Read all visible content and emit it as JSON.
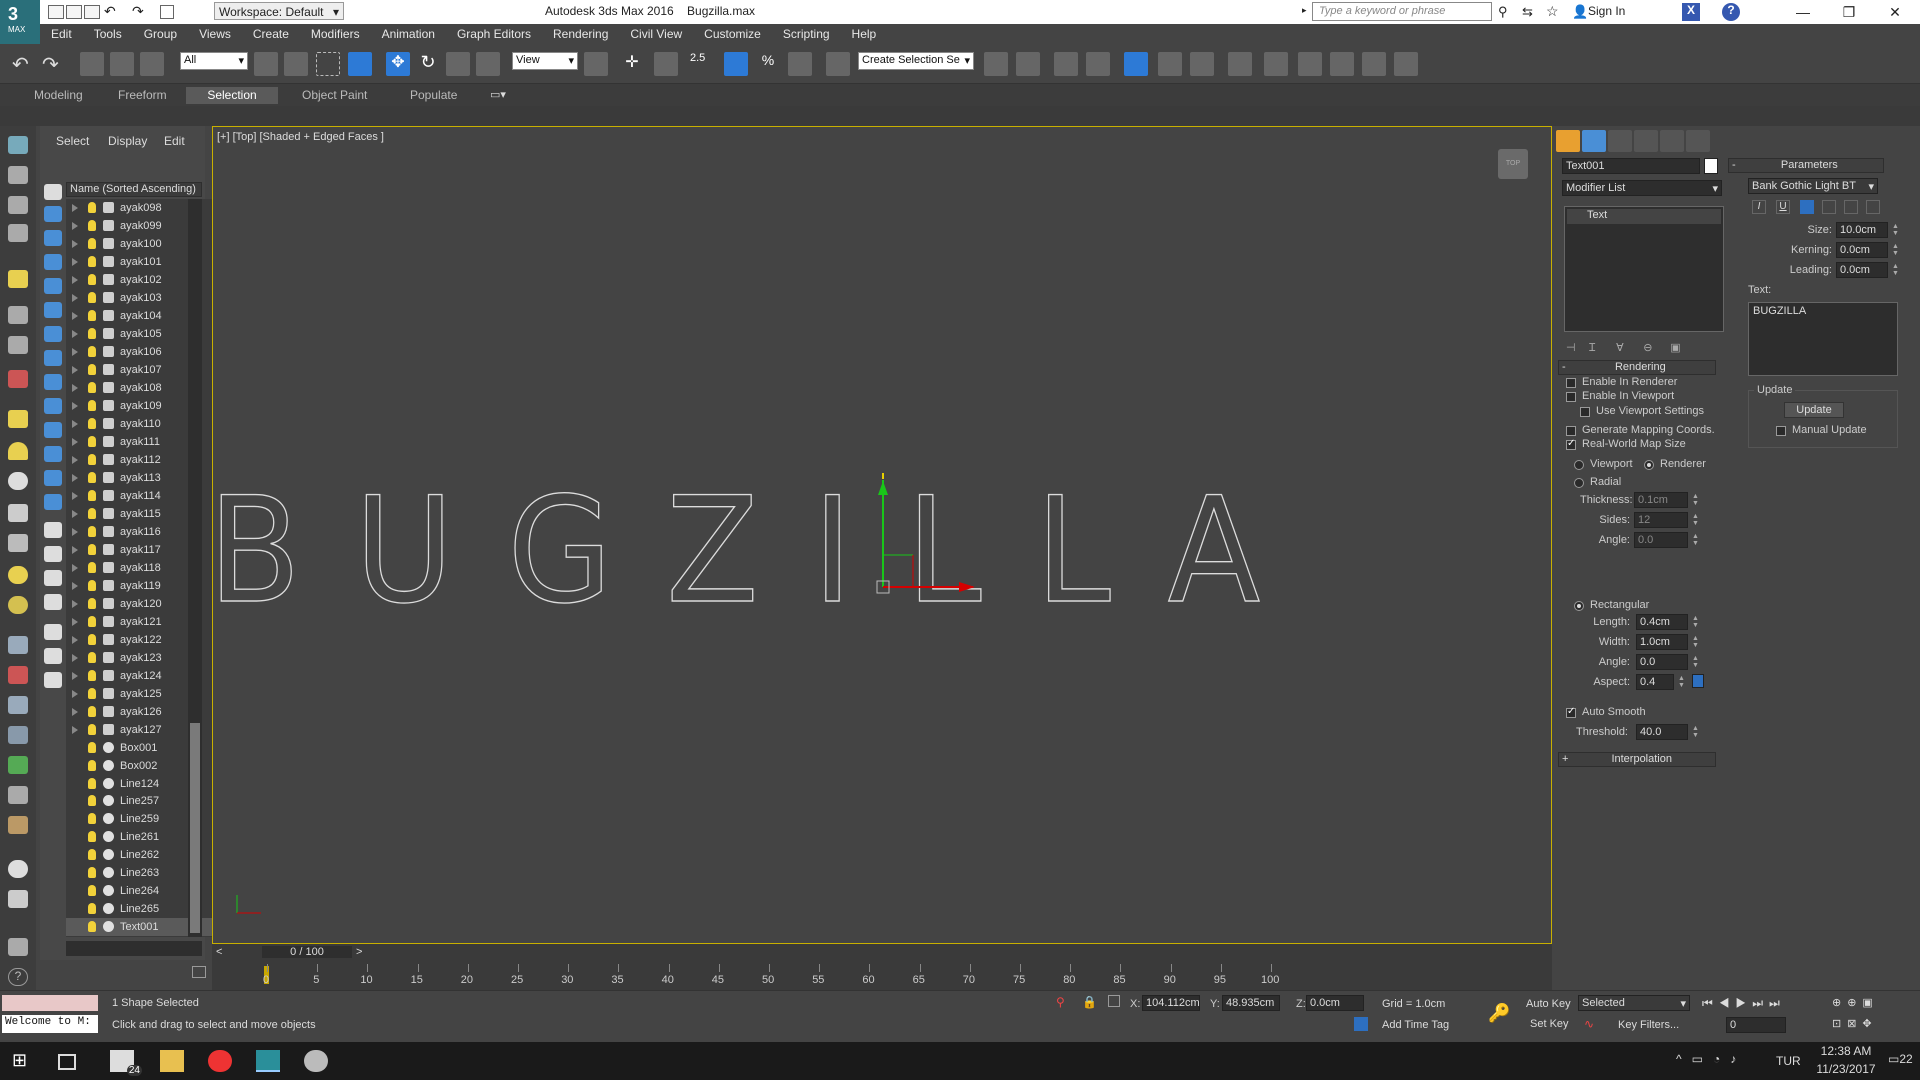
{
  "titlebar": {
    "workspace": "Workspace: Default",
    "app_title": "Autodesk 3ds Max 2016",
    "file_name": "Bugzilla.max",
    "search_placeholder": "Type a keyword or phrase",
    "signin": "Sign In"
  },
  "menu": [
    "Edit",
    "Tools",
    "Group",
    "Views",
    "Create",
    "Modifiers",
    "Animation",
    "Graph Editors",
    "Rendering",
    "Civil View",
    "Customize",
    "Scripting",
    "Help"
  ],
  "toolbar": {
    "filter_select": "All",
    "view_select": "View",
    "snap_value": "2.5",
    "selection_set": "Create Selection Se"
  },
  "ribbon": {
    "tabs": [
      "Modeling",
      "Freeform",
      "Selection",
      "Object Paint",
      "Populate"
    ],
    "active": "Selection"
  },
  "explorer": {
    "tabs": [
      "Select",
      "Display",
      "Edit"
    ],
    "header": "Name (Sorted Ascending)",
    "items": [
      "ayak098",
      "ayak099",
      "ayak100",
      "ayak101",
      "ayak102",
      "ayak103",
      "ayak104",
      "ayak105",
      "ayak106",
      "ayak107",
      "ayak108",
      "ayak109",
      "ayak110",
      "ayak111",
      "ayak112",
      "ayak113",
      "ayak114",
      "ayak115",
      "ayak116",
      "ayak117",
      "ayak118",
      "ayak119",
      "ayak120",
      "ayak121",
      "ayak122",
      "ayak123",
      "ayak124",
      "ayak125",
      "ayak126",
      "ayak127",
      "Box001",
      "Box002",
      "Line124",
      "Line257",
      "Line259",
      "Line261",
      "Line262",
      "Line263",
      "Line264",
      "Line265",
      "Text001"
    ],
    "selected": "Text001"
  },
  "viewport": {
    "label": "[+] [Top] [Shaded + Edged Faces ]",
    "text": "BUGZILLA",
    "viewcube": "TOP"
  },
  "timeline": {
    "frame_counter": "0 / 100",
    "ticks": [
      "0",
      "5",
      "10",
      "15",
      "20",
      "25",
      "30",
      "35",
      "40",
      "45",
      "50",
      "55",
      "60",
      "65",
      "70",
      "75",
      "80",
      "85",
      "90",
      "95",
      "100"
    ]
  },
  "cmd": {
    "object_name": "Text001",
    "modifier_list": "Modifier List",
    "stack_item": "Text",
    "rendering": {
      "title": "Rendering",
      "enable_renderer": "Enable In Renderer",
      "enable_viewport": "Enable In Viewport",
      "use_viewport_settings": "Use Viewport Settings",
      "gen_mapping": "Generate Mapping Coords.",
      "real_world": "Real-World Map Size",
      "viewport": "Viewport",
      "renderer": "Renderer",
      "radial": "Radial",
      "thickness_l": "Thickness:",
      "thickness": "0.1cm",
      "sides_l": "Sides:",
      "sides": "12",
      "angle_l": "Angle:",
      "angle": "0.0",
      "rectangular": "Rectangular",
      "length_l": "Length:",
      "length": "0.4cm",
      "width_l": "Width:",
      "width": "1.0cm",
      "angle2_l": "Angle:",
      "angle2": "0.0",
      "aspect_l": "Aspect:",
      "aspect": "0.4",
      "auto_smooth": "Auto Smooth",
      "threshold_l": "Threshold:",
      "threshold": "40.0"
    },
    "interpolation": "Interpolation",
    "parameters": {
      "title": "Parameters",
      "font": "Bank Gothic Light BT",
      "size_l": "Size:",
      "size": "10.0cm",
      "kerning_l": "Kerning:",
      "kerning": "0.0cm",
      "leading_l": "Leading:",
      "leading": "0.0cm",
      "text_l": "Text:",
      "text": "BUGZILLA",
      "update_group": "Update",
      "update_btn": "Update",
      "manual_update": "Manual Update"
    }
  },
  "status": {
    "welcome": "Welcome to M:",
    "selected": "1 Shape Selected",
    "prompt": "Click and drag to select and move objects",
    "x_l": "X:",
    "x": "104.112cm",
    "y_l": "Y:",
    "y": "48.935cm",
    "z_l": "Z:",
    "z": "0.0cm",
    "grid": "Grid = 1.0cm",
    "auto_key": "Auto Key",
    "set_key": "Set Key",
    "key_mode": "Selected",
    "key_filters": "Key Filters...",
    "add_time_tag": "Add Time Tag",
    "current_frame": "0"
  },
  "taskbar": {
    "badge": "24",
    "lang": "TUR",
    "time": "12:38 AM",
    "date": "11/23/2017",
    "notif": "22"
  }
}
